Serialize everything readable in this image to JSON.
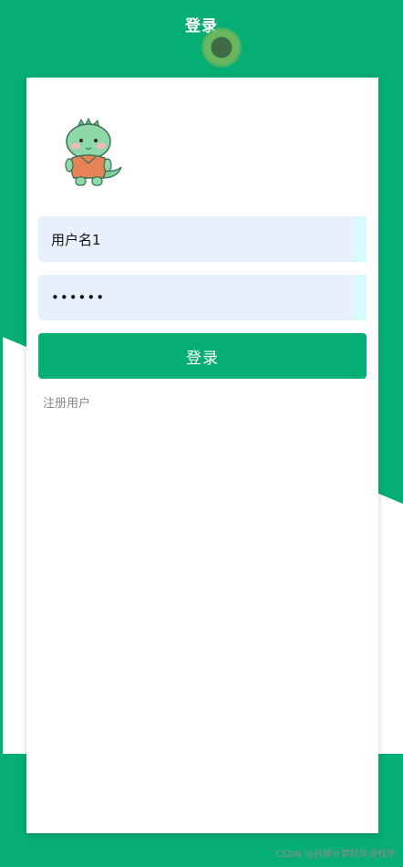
{
  "header": {
    "title": "登录"
  },
  "form": {
    "username_value": "用户名1",
    "password_mask": "••••••",
    "login_button": "登录",
    "register_link": "注册用户"
  },
  "watermark": "CSDN @召楠计算机毕设程序",
  "colors": {
    "accent": "#05ae73",
    "input_bg": "#e8f0fe"
  },
  "icons": {
    "avatar": "dinosaur-mascot-icon"
  }
}
